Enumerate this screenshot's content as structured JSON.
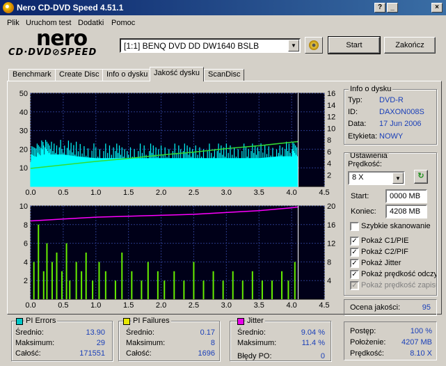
{
  "window": {
    "title": "Nero CD-DVD Speed 4.51.1",
    "btn_help": "?",
    "btn_min": "_",
    "btn_close": "×"
  },
  "menu": [
    "Plik",
    "Uruchom test",
    "Dodatki",
    "Pomoc"
  ],
  "logo": {
    "brand": "nero",
    "product": "CD·DVD⊘SPEED"
  },
  "drive": {
    "selected": "[1:1]  BENQ DVD DD DW1640 BSLB"
  },
  "buttons": {
    "start": "Start",
    "end": "Zakończ"
  },
  "tabs": [
    "Benchmark",
    "Create Disc",
    "Info o dysku",
    "Jakość dysku",
    "ScanDisc"
  ],
  "active_tab": 3,
  "disc_info": {
    "title": "Info o dysku",
    "rows": [
      {
        "label": "Typ:",
        "value": "DVD-R"
      },
      {
        "label": "ID:",
        "value": "DAXON008S"
      },
      {
        "label": "Data:",
        "value": "17 Jun 2006"
      },
      {
        "label": "Etykieta:",
        "value": "NOWY"
      }
    ]
  },
  "settings": {
    "title": "Ustawienia",
    "speed_label": "Prędkość:",
    "speed_value": "8 X",
    "start_label": "Start:",
    "start_value": "0000 MB",
    "end_label": "Koniec:",
    "end_value": "4208 MB",
    "checkboxes": [
      {
        "label": "Szybkie skanowanie",
        "checked": false,
        "disabled": false
      },
      {
        "label": "Pokaż C1/PIE",
        "checked": true,
        "disabled": false
      },
      {
        "label": "Pokaż C2/PIF",
        "checked": true,
        "disabled": false
      },
      {
        "label": "Pokaż Jitter",
        "checked": true,
        "disabled": false
      },
      {
        "label": "Pokaż prędkość odczytu",
        "checked": true,
        "disabled": false
      },
      {
        "label": "Pokaż prędkość zapisu",
        "checked": true,
        "disabled": true
      }
    ]
  },
  "quality": {
    "label": "Ocena jakości:",
    "value": "95"
  },
  "pi_errors": {
    "title": "PI Errors",
    "color": "#00c8c8",
    "avg_label": "Średnio:",
    "avg": "13.90",
    "max_label": "Maksimum:",
    "max": "29",
    "total_label": "Całość:",
    "total": "171551"
  },
  "pi_failures": {
    "title": "PI Failures",
    "color": "#e8e800",
    "avg_label": "Średnio:",
    "avg": "0.17",
    "max_label": "Maksimum:",
    "max": "8",
    "total_label": "Całość:",
    "total": "1696"
  },
  "jitter": {
    "title": "Jitter",
    "color": "#e800e8",
    "avg_label": "Średnio:",
    "avg": "9.04 %",
    "max_label": "Maksimum:",
    "max": "11.4 %",
    "po_label": "Błędy PO:",
    "po": "0"
  },
  "progress": {
    "progress_label": "Postęp:",
    "progress": "100 %",
    "position_label": "Położenie:",
    "position": "4207 MB",
    "speed_label": "Prędkość:",
    "speed": "8.10 X"
  },
  "chart_data": [
    {
      "type": "area",
      "name": "top",
      "x_ticks": [
        "0.0",
        "0.5",
        "1.0",
        "1.5",
        "2.0",
        "2.5",
        "3.0",
        "3.5",
        "4.0",
        "4.5"
      ],
      "y_left_ticks": [
        "10",
        "20",
        "30",
        "40",
        "50"
      ],
      "y_right_ticks": [
        "2",
        "4",
        "6",
        "8",
        "10",
        "12",
        "14",
        "16"
      ],
      "xlim": [
        0,
        4.5
      ],
      "ylim_left": [
        0,
        50
      ],
      "ylim_right": [
        0,
        16
      ],
      "data_end": 4.1,
      "series": [
        {
          "name": "PI Errors",
          "color": "#00ffff",
          "kind": "area",
          "x": [
            0.0,
            0.1,
            0.2,
            0.3,
            0.5,
            0.7,
            1.0,
            1.3,
            1.5,
            1.8,
            2.0,
            2.3,
            2.5,
            2.8,
            3.0,
            3.3,
            3.5,
            3.8,
            4.0,
            4.1
          ],
          "values": [
            13,
            16,
            17,
            17,
            17,
            16,
            15,
            15,
            15,
            15,
            15,
            15,
            15,
            15,
            15,
            15,
            15,
            16,
            16,
            16
          ]
        },
        {
          "name": "Read speed",
          "color": "#33dd33",
          "kind": "line",
          "x": [
            0.0,
            0.5,
            1.0,
            1.5,
            2.0,
            2.5,
            3.0,
            3.5,
            4.0,
            4.1
          ],
          "values": [
            3.1,
            3.7,
            4.3,
            4.8,
            5.4,
            5.9,
            6.5,
            7.0,
            7.6,
            7.7
          ]
        }
      ]
    },
    {
      "type": "bar",
      "name": "bottom",
      "x_ticks": [
        "0.0",
        "0.5",
        "1.0",
        "1.5",
        "2.0",
        "2.5",
        "3.0",
        "3.5",
        "4.0",
        "4.5"
      ],
      "y_left_ticks": [
        "2",
        "4",
        "6",
        "8",
        "10"
      ],
      "y_right_ticks": [
        "4",
        "8",
        "12",
        "16",
        "20"
      ],
      "xlim": [
        0,
        4.5
      ],
      "ylim_left": [
        0,
        10
      ],
      "ylim_right": [
        0,
        20
      ],
      "data_end": 4.1,
      "series": [
        {
          "name": "PI Failures",
          "color": "#66ee00",
          "kind": "bars",
          "x": [
            0.05,
            0.12,
            0.2,
            0.25,
            0.33,
            0.4,
            0.48,
            0.55,
            0.6,
            0.7,
            0.78,
            0.85,
            0.95,
            1.05,
            1.15,
            1.3,
            1.4,
            1.55,
            1.7,
            1.8,
            1.95,
            2.05,
            2.2,
            2.35,
            2.5,
            2.65,
            2.8,
            2.95,
            3.1,
            3.25,
            3.4,
            3.55,
            3.7,
            3.85,
            3.95,
            4.05
          ],
          "values": [
            4,
            8,
            3,
            6,
            4,
            5,
            3,
            6,
            2,
            4,
            3,
            5,
            2,
            4,
            3,
            2,
            5,
            3,
            2,
            4,
            3,
            2,
            3,
            2,
            4,
            2,
            3,
            2,
            3,
            2,
            3,
            2,
            2,
            3,
            2,
            4
          ]
        },
        {
          "name": "Jitter",
          "color": "#ff00ff",
          "kind": "line",
          "x": [
            0.0,
            0.5,
            1.0,
            1.5,
            2.0,
            2.5,
            3.0,
            3.5,
            4.0,
            4.1
          ],
          "values": [
            8.4,
            8.6,
            8.8,
            8.9,
            9.0,
            9.1,
            9.3,
            9.5,
            9.8,
            9.9
          ]
        }
      ]
    }
  ]
}
